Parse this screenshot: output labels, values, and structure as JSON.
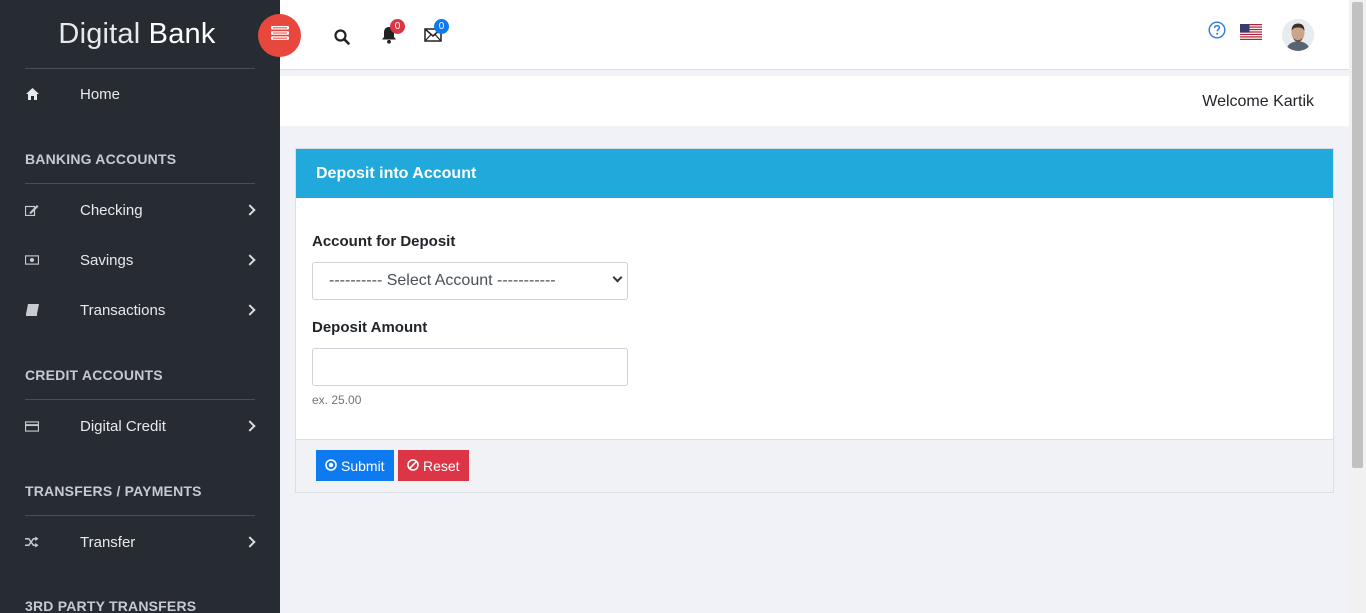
{
  "brand": {
    "light": "Digital ",
    "bold": "Bank"
  },
  "header": {
    "notifications_count": "0",
    "messages_count": "0",
    "welcome": "Welcome Kartik"
  },
  "sidebar": {
    "home": "Home",
    "sections": [
      {
        "title": "BANKING ACCOUNTS",
        "items": [
          "Checking",
          "Savings",
          "Transactions"
        ]
      },
      {
        "title": "CREDIT ACCOUNTS",
        "items": [
          "Digital Credit"
        ]
      },
      {
        "title": "TRANSFERS / PAYMENTS",
        "items": [
          "Transfer"
        ]
      },
      {
        "title": "3RD PARTY TRANSFERS",
        "items": []
      }
    ]
  },
  "form": {
    "title": "Deposit into Account",
    "account_label": "Account for Deposit",
    "account_selected": "---------- Select Account -----------",
    "amount_label": "Deposit Amount",
    "amount_value": "",
    "amount_hint": "ex. 25.00",
    "submit_label": "Submit",
    "reset_label": "Reset"
  },
  "colors": {
    "sidebar_bg": "#272c33",
    "card_header": "#22a9db",
    "submit": "#0d7af0",
    "reset": "#dc3545",
    "toggle": "#e8473d"
  },
  "icons": {
    "home": "home-icon",
    "checking": "edit-icon",
    "savings": "money-icon",
    "transactions": "book-icon",
    "credit": "credit-card-icon",
    "transfer": "shuffle-icon"
  }
}
